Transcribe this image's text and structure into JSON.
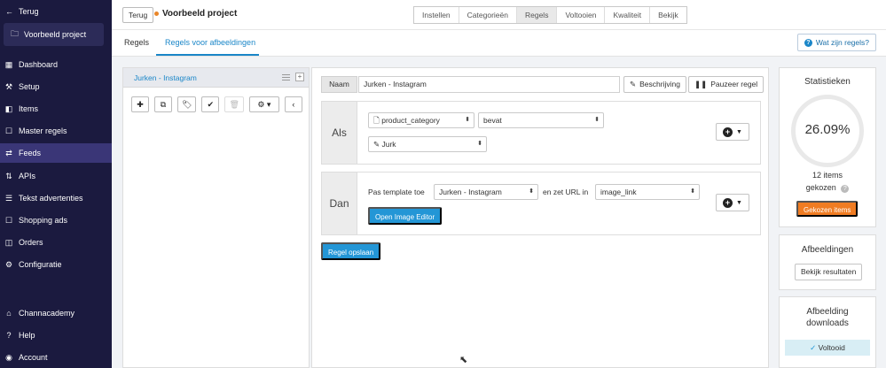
{
  "sidebar": {
    "back_label": "Terug",
    "project_name": "Voorbeeld project",
    "items": [
      {
        "label": "Dashboard",
        "icon": "dashboard-icon",
        "glyph": "▦",
        "active": false
      },
      {
        "label": "Setup",
        "icon": "setup-icon",
        "glyph": "⚒",
        "active": false
      },
      {
        "label": "Items",
        "icon": "items-icon",
        "glyph": "◧",
        "active": false
      },
      {
        "label": "Master regels",
        "icon": "master-rules-icon",
        "glyph": "☐",
        "active": false
      },
      {
        "label": "Feeds",
        "icon": "feeds-icon",
        "glyph": "⇄",
        "active": true
      },
      {
        "label": "APIs",
        "icon": "api-icon",
        "glyph": "⇅",
        "active": false
      },
      {
        "label": "Tekst advertenties",
        "icon": "text-ads-icon",
        "glyph": "☰",
        "active": false
      },
      {
        "label": "Shopping ads",
        "icon": "shopping-icon",
        "glyph": "☐",
        "active": false
      },
      {
        "label": "Orders",
        "icon": "orders-icon",
        "glyph": "◫",
        "active": false
      },
      {
        "label": "Configuratie",
        "icon": "config-icon",
        "glyph": "⚙",
        "active": false
      }
    ],
    "bottom_items": [
      {
        "label": "Channacademy",
        "icon": "academy-icon",
        "glyph": "⌂"
      },
      {
        "label": "Help",
        "icon": "help-icon",
        "glyph": "?"
      },
      {
        "label": "Account",
        "icon": "account-icon",
        "glyph": "◉"
      }
    ]
  },
  "topbar": {
    "back_button": "Terug",
    "project_title": "Voorbeeld project",
    "steps": [
      {
        "label": "Instellen",
        "active": false
      },
      {
        "label": "Categorieën",
        "active": false
      },
      {
        "label": "Regels",
        "active": true
      },
      {
        "label": "Voltooien",
        "active": false
      },
      {
        "label": "Kwaliteit",
        "active": false
      },
      {
        "label": "Bekijk",
        "active": false
      }
    ]
  },
  "subtabs": {
    "tabs": [
      {
        "label": "Regels",
        "active": false
      },
      {
        "label": "Regels voor afbeeldingen",
        "active": true
      }
    ],
    "help_button": "Wat zijn regels?"
  },
  "rules_panel": {
    "rule_name": "Jurken - Instagram",
    "toolbar": [
      {
        "icon": "plus-icon",
        "glyph": "✚"
      },
      {
        "icon": "copy-icon",
        "glyph": "⧉"
      },
      {
        "icon": "tag-icon",
        "glyph": "🏷"
      },
      {
        "icon": "check-icon",
        "glyph": "✔"
      },
      {
        "icon": "trash-icon",
        "glyph": "🗑"
      },
      {
        "icon": "gear-icon",
        "glyph": "⚙ ▾"
      },
      {
        "icon": "chevron-left-icon",
        "glyph": "‹"
      }
    ]
  },
  "editor": {
    "name_label": "Naam",
    "name_value": "Jurken - Instagram",
    "description_button": "Beschrijving",
    "pause_button": "Pauzeer regel",
    "if_block": {
      "label": "Als",
      "field": "product_category",
      "operator": "bevat",
      "value": "Jurk"
    },
    "then_block": {
      "label": "Dan",
      "text_apply": "Pas template toe",
      "template": "Jurken - Instagram",
      "text_url": "en zet URL in",
      "url_field": "image_link",
      "image_editor_button": "Open Image Editor"
    },
    "save_button": "Regel opslaan"
  },
  "stats": {
    "title": "Statistieken",
    "percentage": "26.09%",
    "percentage_value": 26.09,
    "items_count": "12 items",
    "items_label": "gekozen",
    "chosen_button": "Gekozen items"
  },
  "images_card": {
    "title": "Afbeeldingen",
    "button": "Bekijk resultaten"
  },
  "downloads_card": {
    "title": "Afbeelding downloads",
    "status": "Voltooid"
  },
  "colors": {
    "sidebar_bg": "#1b1a3f",
    "accent_blue": "#2396d6",
    "accent_orange": "#f07c22",
    "project_dot": "#e8862a"
  }
}
